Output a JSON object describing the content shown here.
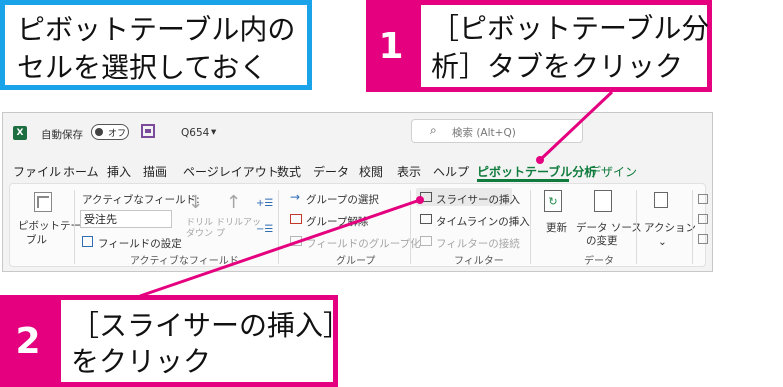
{
  "callout_top_left": {
    "line1": "ピボットテーブル内の",
    "line2": "セルを選択しておく"
  },
  "step1": {
    "number": "1",
    "line1": "［ピボットテーブル分",
    "line2": "析］タブをクリック"
  },
  "step2": {
    "number": "2",
    "line1": "［スライサーの挿入］",
    "line2": "をクリック"
  },
  "titlebar": {
    "autosave_label": "自動保存",
    "toggle_state": "オフ",
    "filename": "Q654",
    "search_placeholder": "検索 (Alt+Q)"
  },
  "menu": [
    "ファイル",
    "ホーム",
    "挿入",
    "描画",
    "ページレイアウト",
    "数式",
    "データ",
    "校閲",
    "表示",
    "ヘルプ",
    "ピボットテーブル分析",
    "デザイン"
  ],
  "ribbon": {
    "pivot_button": {
      "line1": "ピボットテー",
      "line2": "ブル"
    },
    "active_field": {
      "label": "アクティブなフィールド:",
      "value": "受注先",
      "settings": "フィールドの設定",
      "drilldown": "ドリル\nダウン",
      "drillup": "ドリルアッ\nプ",
      "group_label": "アクティブなフィールド"
    },
    "group": {
      "select": "グループの選択",
      "ungroup": "グループ解除",
      "field_group": "フィールドのグループ化",
      "group_label": "グループ"
    },
    "filter": {
      "insert_slicer": "スライサーの挿入",
      "insert_timeline": "タイムラインの挿入",
      "filter_connections": "フィルターの接続",
      "group_label": "フィルター"
    },
    "data": {
      "refresh": "更新",
      "change_source_line1": "データ ソース",
      "change_source_line2": "の変更",
      "group_label": "データ"
    },
    "actions": {
      "label": "アクション"
    }
  },
  "colors": {
    "magenta": "#e4007f",
    "blue": "#1aa3e8",
    "excel_green": "#0f7b3c"
  }
}
